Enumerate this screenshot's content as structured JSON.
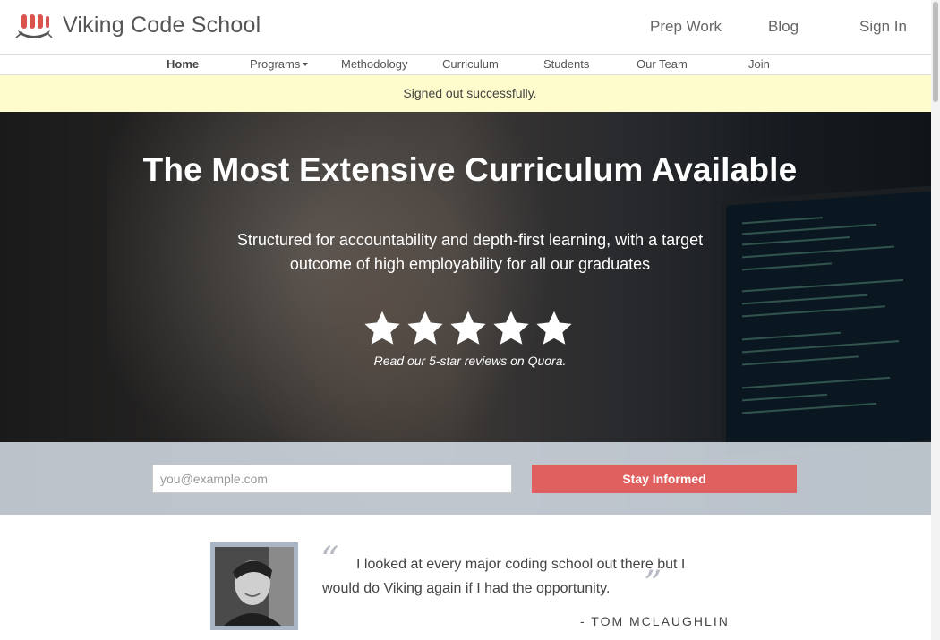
{
  "header": {
    "brand": "Viking Code School",
    "links": [
      "Prep Work",
      "Blog",
      "Sign In"
    ]
  },
  "subnav": {
    "items": [
      "Home",
      "Programs",
      "Methodology",
      "Curriculum",
      "Students",
      "Our Team",
      "Join"
    ],
    "active": "Home"
  },
  "alert": {
    "text": "Signed out successfully."
  },
  "hero": {
    "title": "The Most Extensive Curriculum Available",
    "subtitle": "Structured for accountability and depth-first learning, with a target outcome of high employability for all our graduates",
    "rating": 5,
    "review_text": "Read our 5-star reviews on Quora."
  },
  "signup": {
    "email_placeholder": "you@example.com",
    "button_label": "Stay Informed"
  },
  "testimonial": {
    "quote": "I looked at every major coding school out there but I would do Viking again if I had the opportunity.",
    "author": "- TOM MCLAUGHLIN"
  },
  "colors": {
    "accent": "#e06060",
    "alert_bg": "#fefbcd",
    "logo_red": "#d9534f"
  }
}
